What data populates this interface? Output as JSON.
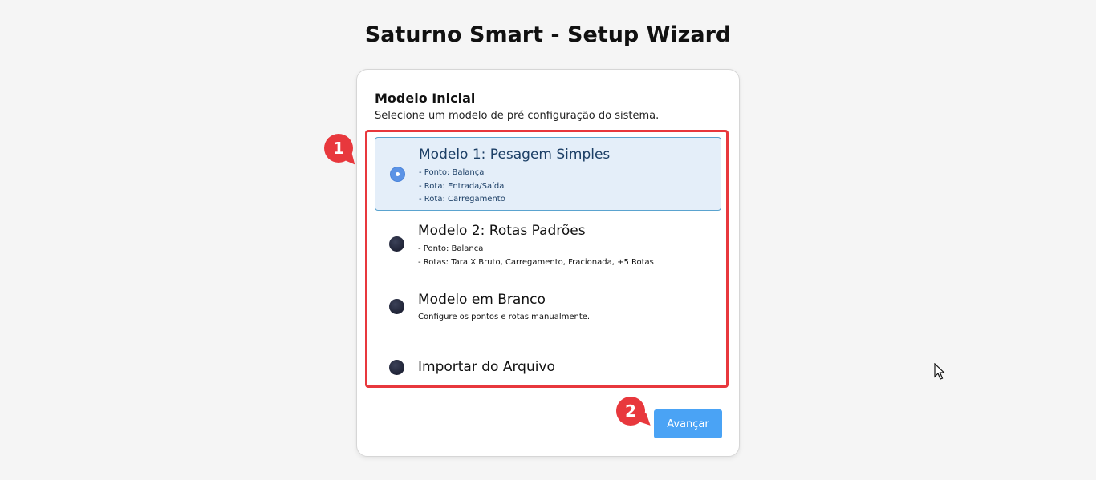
{
  "page": {
    "title": "Saturno Smart - Setup Wizard"
  },
  "wizard": {
    "section_title": "Modelo Inicial",
    "section_subtitle": "Selecione um modelo de pré configuração do sistema.",
    "options": [
      {
        "title": "Modelo 1: Pesagem Simples",
        "selected": true,
        "lines": [
          "- Ponto: Balança",
          "- Rota: Entrada/Saída",
          "- Rota: Carregamento"
        ]
      },
      {
        "title": "Modelo 2: Rotas Padrões",
        "selected": false,
        "lines": [
          "- Ponto: Balança",
          "- Rotas: Tara X Bruto, Carregamento, Fracionada, +5 Rotas"
        ]
      },
      {
        "title": "Modelo em Branco",
        "selected": false,
        "lines": [
          "Configure os pontos e rotas manualmente."
        ]
      },
      {
        "title": "Importar do Arquivo",
        "selected": false,
        "lines": []
      }
    ],
    "next_label": "Avançar"
  },
  "annotations": {
    "marker_1": "1",
    "marker_2": "2"
  },
  "colors": {
    "accent_button": "#4aa3f5",
    "selected_bg": "#e4eef9",
    "annotation_red": "#e8383d"
  }
}
